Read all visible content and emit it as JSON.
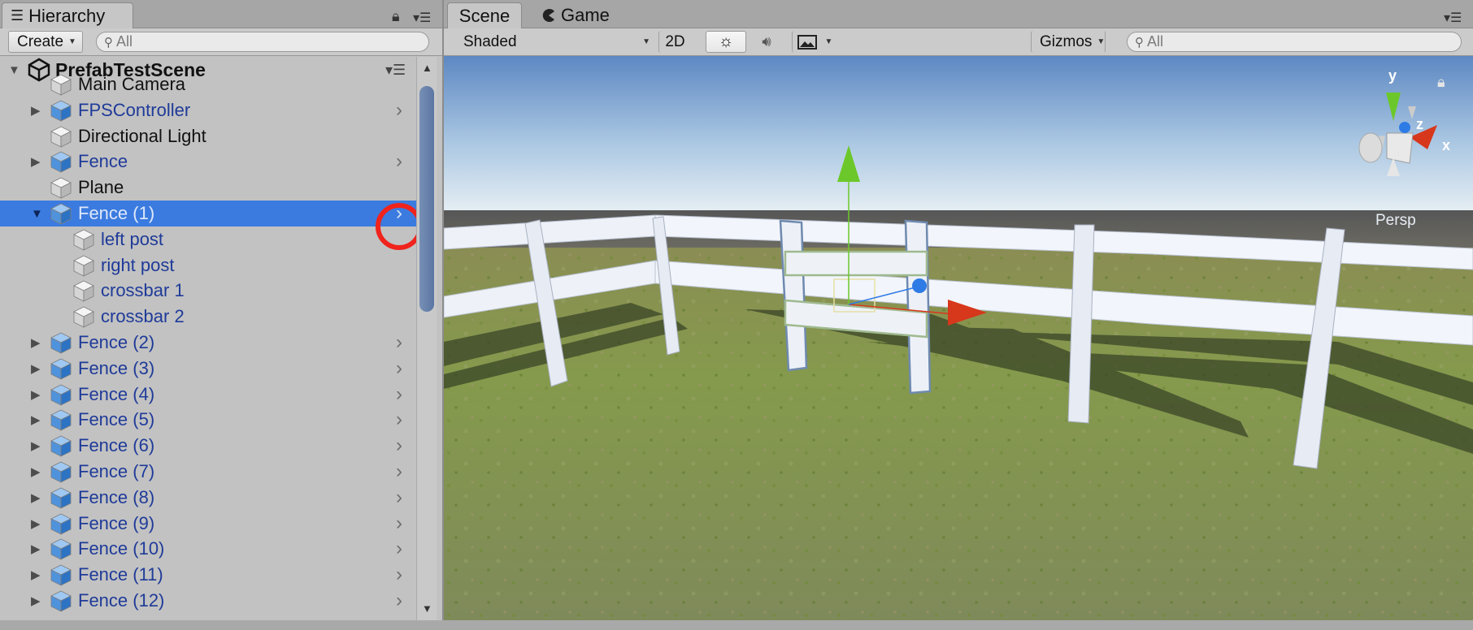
{
  "hierarchy": {
    "tab_label": "Hierarchy",
    "create_label": "Create",
    "search_placeholder": "All",
    "scene_name": "PrefabTestScene",
    "items": [
      {
        "label": "Main Camera",
        "prefab": false,
        "foldout": "",
        "chevron": false,
        "depth": 0
      },
      {
        "label": "FPSController",
        "prefab": true,
        "foldout": "▶",
        "chevron": true,
        "depth": 0
      },
      {
        "label": "Directional Light",
        "prefab": false,
        "foldout": "",
        "chevron": false,
        "depth": 0
      },
      {
        "label": "Fence",
        "prefab": true,
        "foldout": "▶",
        "chevron": true,
        "depth": 0
      },
      {
        "label": "Plane",
        "prefab": false,
        "foldout": "",
        "chevron": false,
        "depth": 0
      },
      {
        "label": "Fence (1)",
        "prefab": true,
        "foldout": "▼",
        "chevron": true,
        "depth": 0,
        "selected": true
      },
      {
        "label": "left post",
        "prefab": true,
        "foldout": "",
        "chevron": false,
        "depth": 1,
        "child": true
      },
      {
        "label": "right post",
        "prefab": true,
        "foldout": "",
        "chevron": false,
        "depth": 1,
        "child": true
      },
      {
        "label": "crossbar 1",
        "prefab": true,
        "foldout": "",
        "chevron": false,
        "depth": 1,
        "child": true
      },
      {
        "label": "crossbar 2",
        "prefab": true,
        "foldout": "",
        "chevron": false,
        "depth": 1,
        "child": true
      },
      {
        "label": "Fence (2)",
        "prefab": true,
        "foldout": "▶",
        "chevron": true,
        "depth": 0
      },
      {
        "label": "Fence (3)",
        "prefab": true,
        "foldout": "▶",
        "chevron": true,
        "depth": 0
      },
      {
        "label": "Fence (4)",
        "prefab": true,
        "foldout": "▶",
        "chevron": true,
        "depth": 0
      },
      {
        "label": "Fence (5)",
        "prefab": true,
        "foldout": "▶",
        "chevron": true,
        "depth": 0
      },
      {
        "label": "Fence (6)",
        "prefab": true,
        "foldout": "▶",
        "chevron": true,
        "depth": 0
      },
      {
        "label": "Fence (7)",
        "prefab": true,
        "foldout": "▶",
        "chevron": true,
        "depth": 0
      },
      {
        "label": "Fence (8)",
        "prefab": true,
        "foldout": "▶",
        "chevron": true,
        "depth": 0
      },
      {
        "label": "Fence (9)",
        "prefab": true,
        "foldout": "▶",
        "chevron": true,
        "depth": 0
      },
      {
        "label": "Fence (10)",
        "prefab": true,
        "foldout": "▶",
        "chevron": true,
        "depth": 0
      },
      {
        "label": "Fence (11)",
        "prefab": true,
        "foldout": "▶",
        "chevron": true,
        "depth": 0
      },
      {
        "label": "Fence (12)",
        "prefab": true,
        "foldout": "▶",
        "chevron": true,
        "depth": 0
      }
    ]
  },
  "scene": {
    "tabs": [
      {
        "label": "Scene"
      },
      {
        "label": "Game"
      }
    ],
    "shading_mode": "Shaded",
    "mode_2d_label": "2D",
    "gizmos_label": "Gizmos",
    "search_placeholder": "All",
    "gizmo_axes": {
      "x": "x",
      "y": "y",
      "z": "z"
    },
    "projection_label": "Persp"
  },
  "colors": {
    "selection": "#3b7be0",
    "prefab_text": "#1f3b99",
    "highlight_circle": "#f0231d",
    "axis_x": "#d7371b",
    "axis_y": "#6cc82a",
    "axis_z": "#2f7be6"
  },
  "icons": {
    "hierarchy_tab": "list-icon",
    "game_tab": "pacman-icon",
    "lighting": "sun-icon",
    "audio": "speaker-icon",
    "effects": "image-icon",
    "panel_lock": "lock-icon",
    "panel_menu": "menu-icon",
    "row_chevron": "chevron-right-icon",
    "gameobject": "cube-icon",
    "unity_scene": "unity-logo-icon",
    "search": "magnifier-icon"
  }
}
